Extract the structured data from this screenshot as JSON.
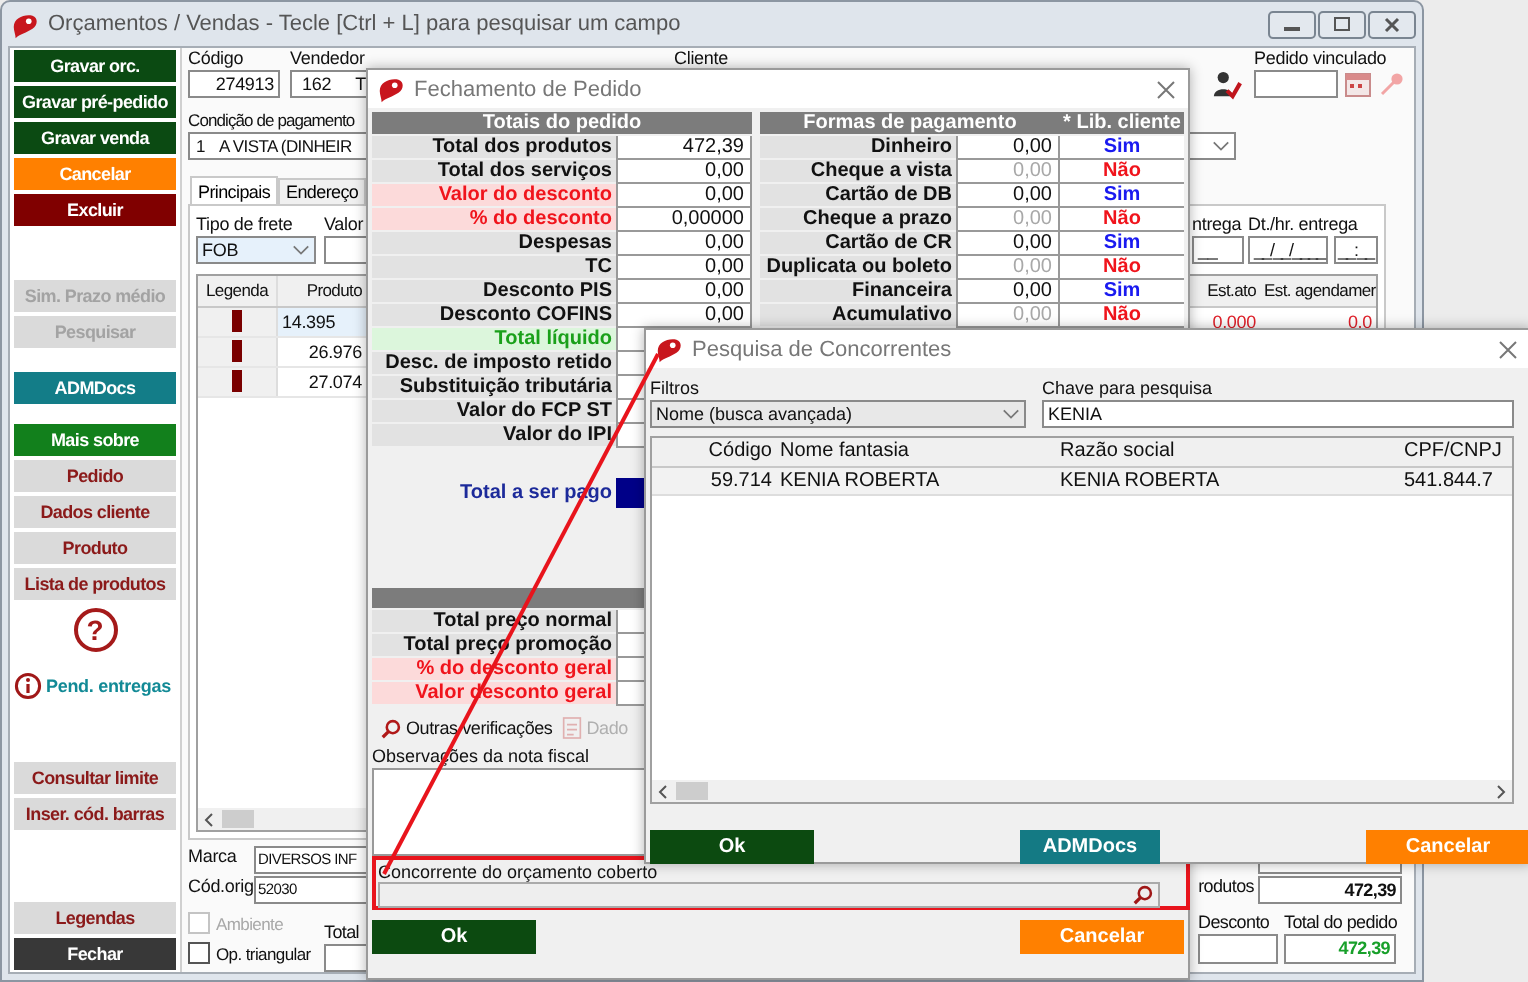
{
  "main_window": {
    "title": "Orçamentos / Vendas - Tecle [Ctrl + L] para pesquisar um campo",
    "sidebar_groups": [
      [
        {
          "kind": "button",
          "label": "Gravar orc.",
          "color": "#0b4a12",
          "disabled": false
        },
        {
          "kind": "button",
          "label": "Gravar pré-pedido",
          "color": "#0b4a12",
          "disabled": false
        },
        {
          "kind": "button",
          "label": "Gravar venda",
          "color": "#0b4a12",
          "disabled": false
        },
        {
          "kind": "button",
          "label": "Cancelar",
          "color": "#ff8000",
          "disabled": false
        },
        {
          "kind": "button",
          "label": "Excluir",
          "color": "#800000",
          "disabled": false
        }
      ],
      [
        {
          "kind": "button",
          "label": "Sim. Prazo médio",
          "color": "#dadada",
          "disabled": true
        },
        {
          "kind": "button",
          "label": "Pesquisar",
          "color": "#dadada",
          "disabled": true
        }
      ],
      [
        {
          "kind": "button",
          "label": "ADMDocs",
          "color": "#137d88",
          "disabled": false
        }
      ],
      [
        {
          "kind": "button",
          "label": "Mais sobre",
          "color": "#12801c",
          "disabled": false
        },
        {
          "kind": "button",
          "label": "Pedido",
          "color": "#dadada",
          "disabled": false
        },
        {
          "kind": "button",
          "label": "Dados cliente",
          "color": "#dadada",
          "disabled": false
        },
        {
          "kind": "button",
          "label": "Produto",
          "color": "#dadada",
          "disabled": false
        },
        {
          "kind": "button",
          "label": "Lista de produtos",
          "color": "#dadada",
          "disabled": false
        },
        {
          "kind": "help",
          "label": "?"
        },
        {
          "kind": "link",
          "label": "Pend. entregas"
        }
      ],
      [
        {
          "kind": "button",
          "label": "Consultar limite",
          "color": "#dadada",
          "disabled": false
        },
        {
          "kind": "button",
          "label": "Inser. cód. barras",
          "color": "#dadada",
          "disabled": false
        }
      ],
      [
        {
          "kind": "button",
          "label": "Legendas",
          "color": "#dadada",
          "disabled": false
        },
        {
          "kind": "button",
          "label": "Fechar",
          "color": "#383838",
          "disabled": false
        }
      ]
    ],
    "codigo": {
      "label": "Código",
      "value": "274913"
    },
    "vendedor": {
      "label": "Vendedor",
      "value": "162",
      "name": "T"
    },
    "cliente_label": "Cliente",
    "pedido_vinculado": {
      "label": "Pedido vinculado"
    },
    "condicao": {
      "label": "Condição de pagamento",
      "code": "1",
      "name": "A VISTA (DINHEIR"
    },
    "tabs": [
      {
        "label": "Principais",
        "selected": true
      },
      {
        "label": "Endereço",
        "selected": false
      }
    ],
    "frete": {
      "label": "Tipo de frete",
      "value": "FOB"
    },
    "valor_label": "Valor",
    "entrega": {
      "label": "ntrega",
      "value": "__"
    },
    "dt_entrega": {
      "label": "Dt./hr. entrega",
      "date": "__/__/____",
      "time": "__:__"
    },
    "products": {
      "columns": [
        "Legenda",
        "Produto",
        "Est.ato",
        "Est. agendamer"
      ],
      "rows": [
        {
          "color": "#7a0000",
          "produto": "14.395",
          "est": "0,000",
          "agend": "0,0",
          "selected": true
        },
        {
          "color": "#7a0000",
          "produto": "26.976",
          "selected": false
        },
        {
          "color": "#7a0000",
          "produto": "27.074",
          "selected": false
        }
      ]
    },
    "marca": {
      "label": "Marca",
      "value": "DIVERSOS INF"
    },
    "cod_orig": {
      "label": "Cód.orig",
      "value": "52030"
    },
    "checkboxes": [
      {
        "label": "Ambiente",
        "checked": false,
        "disabled": true
      },
      {
        "label": "Op. triangular",
        "checked": false,
        "disabled": false
      }
    ],
    "total_f_label": "Total",
    "totals": [
      {
        "label": "rodutos",
        "value": "472,39"
      }
    ],
    "desconto_label": "Desconto",
    "total_pedido": {
      "label": "Total do pedido",
      "value": "472,39"
    }
  },
  "closing_window": {
    "title": "Fechamento de Pedido",
    "totals_header": "Totais do pedido",
    "totals": [
      {
        "label": "Total dos produtos",
        "value": "472,39",
        "kind": "normal"
      },
      {
        "label": "Total dos serviços",
        "value": "0,00",
        "kind": "normal"
      },
      {
        "label": "Valor do desconto",
        "value": "0,00",
        "kind": "discount"
      },
      {
        "label": "% do desconto",
        "value": "0,00000",
        "kind": "discount"
      },
      {
        "label": "Despesas",
        "value": "0,00",
        "kind": "normal"
      },
      {
        "label": "TC",
        "value": "0,00",
        "kind": "normal"
      },
      {
        "label": "Desconto PIS",
        "value": "0,00",
        "kind": "normal"
      },
      {
        "label": "Desconto COFINS",
        "value": "0,00",
        "kind": "normal"
      },
      {
        "label": "Total líquido",
        "kind": "net"
      },
      {
        "label": "Desc. de imposto retido",
        "kind": "normal"
      },
      {
        "label": "Substituição tributária",
        "kind": "normal"
      },
      {
        "label": "Valor do FCP ST",
        "kind": "normal"
      },
      {
        "label": "Valor do IPI",
        "kind": "normal"
      }
    ],
    "pay_total_label": "Total a ser pago",
    "payments_header": "Formas de pagamento",
    "lib_header": "* Lib. cliente",
    "payments": [
      {
        "label": "Dinheiro",
        "value": "0,00",
        "lib": "Sim",
        "enabled": true
      },
      {
        "label": "Cheque a vista",
        "value": "0,00",
        "lib": "Não",
        "enabled": false
      },
      {
        "label": "Cartão de DB",
        "value": "0,00",
        "lib": "Sim",
        "enabled": true
      },
      {
        "label": "Cheque a prazo",
        "value": "0,00",
        "lib": "Não",
        "enabled": false
      },
      {
        "label": "Cartão de CR",
        "value": "0,00",
        "lib": "Sim",
        "enabled": true
      },
      {
        "label": "Duplicata ou boleto",
        "value": "0,00",
        "lib": "Não",
        "enabled": false
      },
      {
        "label": "Financeira",
        "value": "0,00",
        "lib": "Sim",
        "enabled": true
      },
      {
        "label": "Acumulativo",
        "value": "0,00",
        "lib": "Não",
        "enabled": false
      }
    ],
    "price_rows": [
      {
        "label": "Total preço normal",
        "kind": "normal"
      },
      {
        "label": "Total preço promoção",
        "kind": "normal"
      },
      {
        "label": "% do desconto geral",
        "kind": "discount"
      },
      {
        "label": "Valor desconto geral",
        "kind": "discount"
      }
    ],
    "tools": [
      {
        "label": "Outras verificações",
        "disabled": false
      },
      {
        "label": "Dado",
        "disabled": true
      }
    ],
    "notes_label": "Observações da nota fiscal",
    "competitor_label": "Concorrente do orçamento coberto",
    "buttons": [
      {
        "label": "Ok",
        "kind": "ok"
      },
      {
        "label": "Cancelar",
        "kind": "cancel"
      }
    ]
  },
  "search_window": {
    "title": "Pesquisa de Concorrentes",
    "filter": {
      "label": "Filtros",
      "value": "Nome (busca avançada)"
    },
    "key": {
      "label": "Chave para pesquisa",
      "value": "KENIA"
    },
    "columns": [
      "Código",
      "Nome fantasia",
      "Razão social",
      "CPF/CNPJ"
    ],
    "rows": [
      [
        "59.714",
        "KENIA ROBERTA",
        "KENIA ROBERTA",
        "541.844.7"
      ]
    ],
    "buttons": [
      {
        "label": "Ok",
        "kind": "ok"
      },
      {
        "label": "ADMDocs",
        "kind": "docs"
      },
      {
        "label": "Cancelar",
        "kind": "cancel"
      }
    ]
  }
}
